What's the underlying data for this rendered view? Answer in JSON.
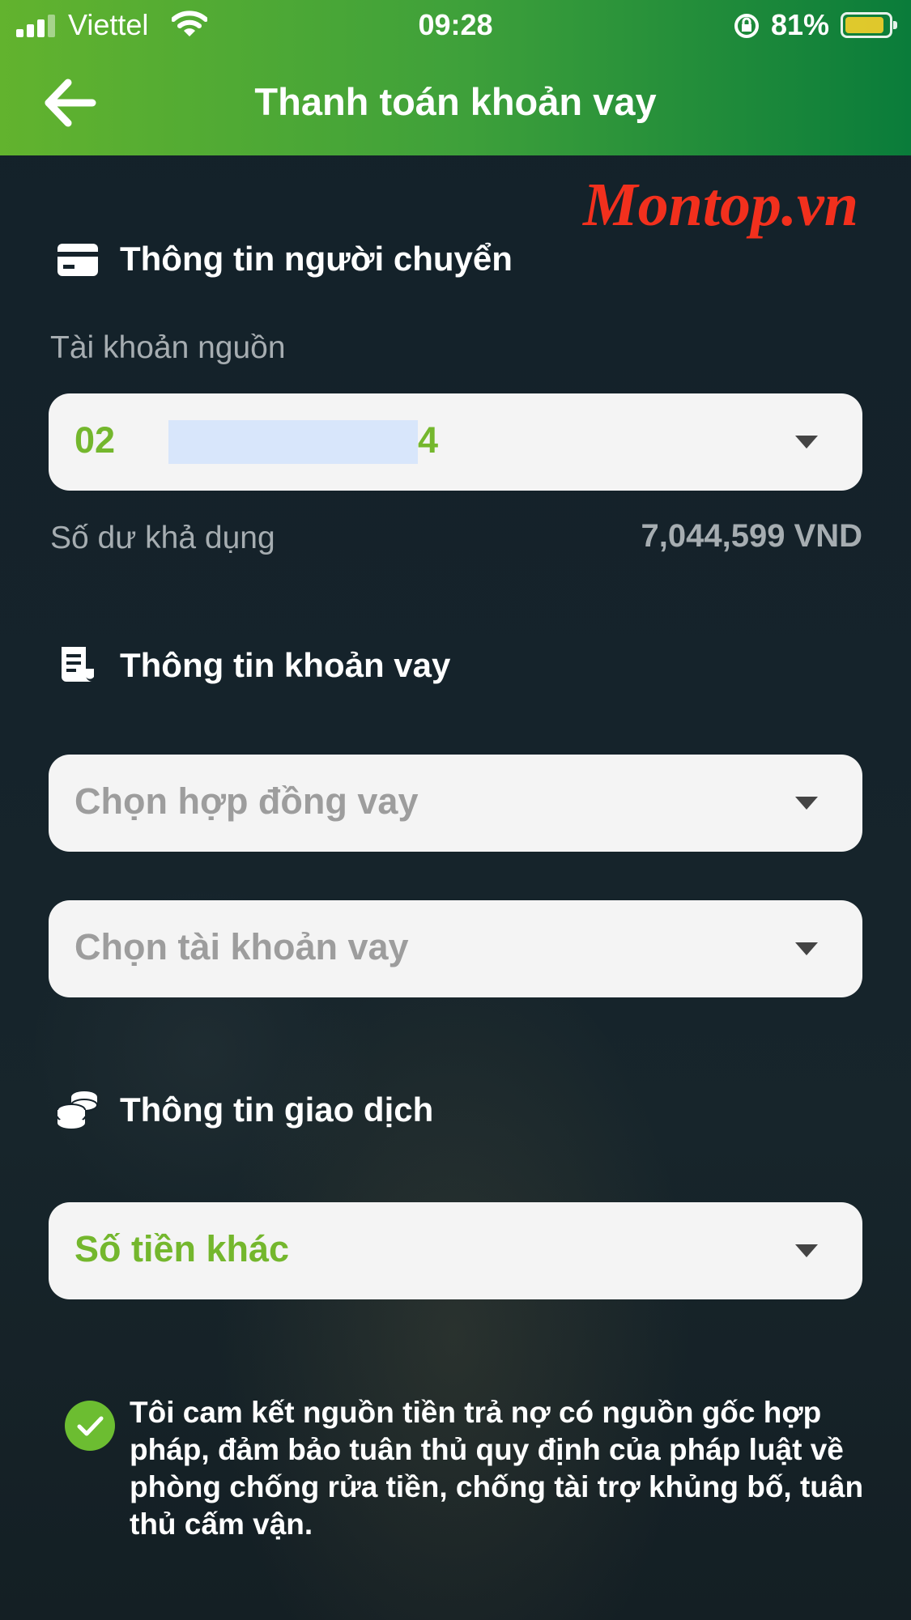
{
  "status_bar": {
    "carrier": "Viettel",
    "time": "09:28",
    "battery": "81%",
    "battery_level": 0.81
  },
  "header": {
    "title": "Thanh toán khoản vay"
  },
  "watermark": "Montop.vn",
  "sender_section": {
    "title": "Thông tin người chuyển",
    "source_account_label": "Tài khoản nguồn",
    "account_prefix": "02",
    "account_suffix": "4",
    "balance_label": "Số dư khả dụng",
    "balance_value": "7,044,599 VND"
  },
  "loan_section": {
    "title": "Thông tin khoản vay",
    "contract_placeholder": "Chọn hợp đồng vay",
    "loan_account_placeholder": "Chọn tài khoản vay"
  },
  "transaction_section": {
    "title": "Thông tin giao dịch",
    "amount_option": "Số tiền khác"
  },
  "commitment": {
    "checked": true,
    "text": "Tôi cam kết nguồn tiền trả nợ có nguồn gốc hợp pháp, đảm bảo tuân thủ quy định của pháp luật về phòng chống rửa tiền, chống tài trợ khủng bố, tuân thủ cấm vận."
  },
  "colors": {
    "header_start": "#62b32e",
    "header_end": "#0a7c3a",
    "accent_green": "#74b72d",
    "watermark_red": "#f2301d",
    "background": "#15222a"
  }
}
